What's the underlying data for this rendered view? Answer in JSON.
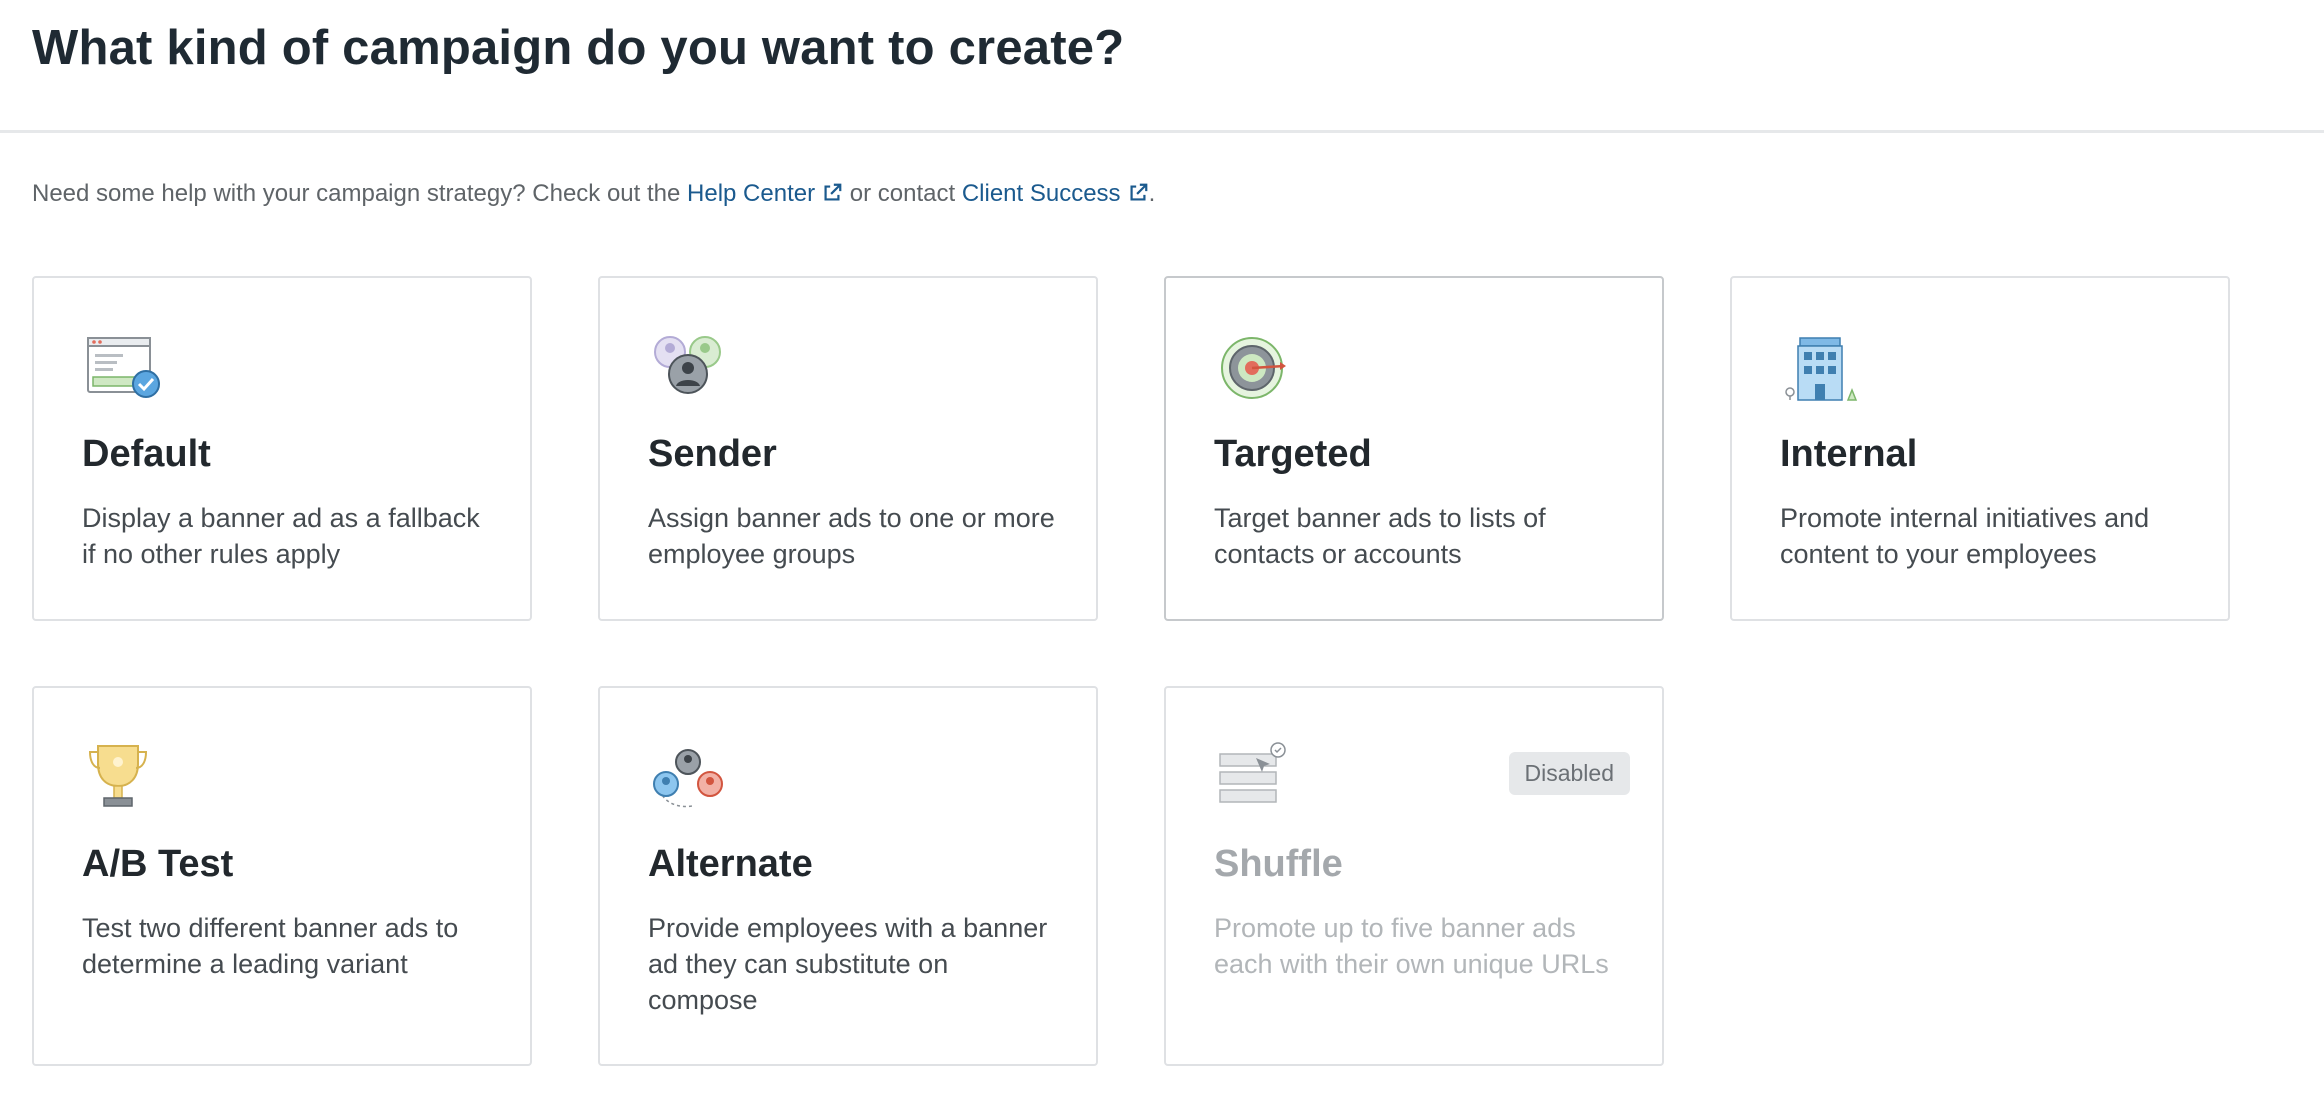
{
  "header": {
    "title": "What kind of campaign do you want to create?"
  },
  "help": {
    "prefix": "Need some help with your campaign strategy? Check out the ",
    "help_center_link": "Help Center",
    "middle": " or contact ",
    "client_success_link": "Client Success",
    "suffix": "."
  },
  "icons": {
    "external_link": "external-link-icon"
  },
  "cards": [
    {
      "title": "Default",
      "description": "Display a banner ad as a fallback if no other rules apply",
      "icon": "browser-badge-icon",
      "state": "normal"
    },
    {
      "title": "Sender",
      "description": "Assign banner ads to one or more employee groups",
      "icon": "user-groups-icon",
      "state": "normal"
    },
    {
      "title": "Targeted",
      "description": "Target banner ads to lists of contacts or accounts",
      "icon": "target-icon",
      "state": "selected"
    },
    {
      "title": "Internal",
      "description": "Promote internal initiatives and content to your employees",
      "icon": "building-icon",
      "state": "normal"
    },
    {
      "title": "A/B Test",
      "description": "Test two different banner ads to determine a leading variant",
      "icon": "trophy-icon",
      "state": "normal"
    },
    {
      "title": "Alternate",
      "description": "Provide employees with a banner ad they can substitute on compose",
      "icon": "rotating-users-icon",
      "state": "normal"
    },
    {
      "title": "Shuffle",
      "description": "Promote up to five banner ads each with their own unique URLs",
      "icon": "shuffle-banners-icon",
      "state": "disabled",
      "badge": "Disabled"
    }
  ],
  "colors": {
    "link": "#1b5a8e",
    "title": "#1f2a33",
    "card_border": "#dfe1e4"
  }
}
